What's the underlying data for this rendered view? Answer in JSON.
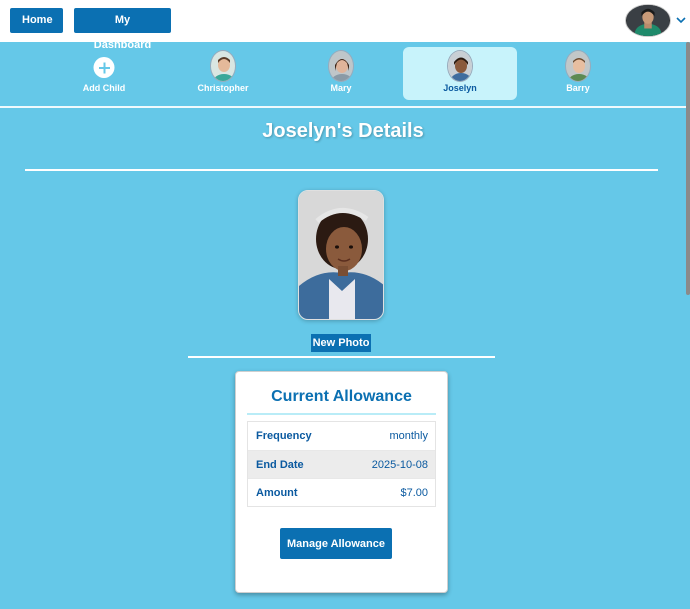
{
  "topbar": {
    "home_label": "Home",
    "dashboard_label": "My Dashboard"
  },
  "children_nav": {
    "add_label": "Add Child",
    "children": [
      {
        "name": "Christopher",
        "active": false
      },
      {
        "name": "Mary",
        "active": false
      },
      {
        "name": "Joselyn",
        "active": true
      },
      {
        "name": "Barry",
        "active": false
      }
    ]
  },
  "details": {
    "title": "Joselyn's Details",
    "new_photo_label": "New Photo"
  },
  "allowance": {
    "title": "Current Allowance",
    "rows": [
      {
        "key": "Frequency",
        "value": "monthly"
      },
      {
        "key": "End Date",
        "value": "2025-10-08"
      },
      {
        "key": "Amount",
        "value": "$7.00"
      }
    ],
    "manage_label": "Manage Allowance"
  },
  "icons": {
    "add": "plus-circle-icon",
    "user_menu": "chevron-down-icon"
  },
  "colors": {
    "background": "#65c8e8",
    "primary": "#0b70b2",
    "active_tab": "#c8f3fb"
  }
}
